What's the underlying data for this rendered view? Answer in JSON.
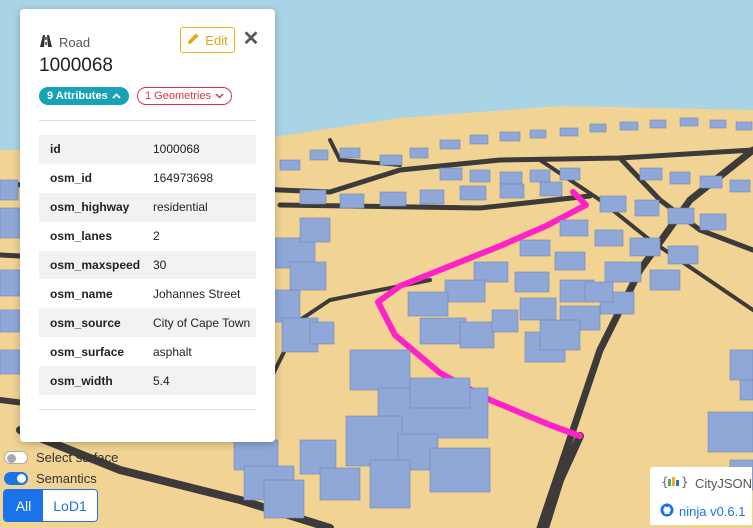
{
  "object": {
    "type_label": "Road",
    "type_icon": "road-icon",
    "id": "1000068",
    "edit_label": "Edit",
    "close_icon": "close-icon",
    "attributes_badge": "9 Attributes",
    "geometries_badge": "1 Geometries",
    "attributes": [
      {
        "key": "id",
        "value": "1000068"
      },
      {
        "key": "osm_id",
        "value": "164973698"
      },
      {
        "key": "osm_highway",
        "value": "residential"
      },
      {
        "key": "osm_lanes",
        "value": "2"
      },
      {
        "key": "osm_maxspeed",
        "value": "30"
      },
      {
        "key": "osm_name",
        "value": "Johannes Street"
      },
      {
        "key": "osm_source",
        "value": "City of Cape Town"
      },
      {
        "key": "osm_surface",
        "value": "asphalt"
      },
      {
        "key": "osm_width",
        "value": "5.4"
      }
    ]
  },
  "controls": {
    "select_surface_label": "Select surface",
    "select_surface_on": false,
    "semantics_label": "Semantics",
    "semantics_on": true,
    "lod_options": [
      "All",
      "LoD1"
    ],
    "lod_selected": "All"
  },
  "brand": {
    "logo_text": "CityJSON",
    "version_text": "ninja v0.6.1"
  },
  "colors": {
    "sky": "#a9d4e6",
    "terrain": "#f1d393",
    "building": "#8fa8d8",
    "road": "#3d3a3a",
    "highlight_road": "#ff22c8",
    "accent": "#1a73e8",
    "attr_badge": "#17a2b8",
    "geom_badge": "#dc3545",
    "edit": "#f0ad1e"
  }
}
